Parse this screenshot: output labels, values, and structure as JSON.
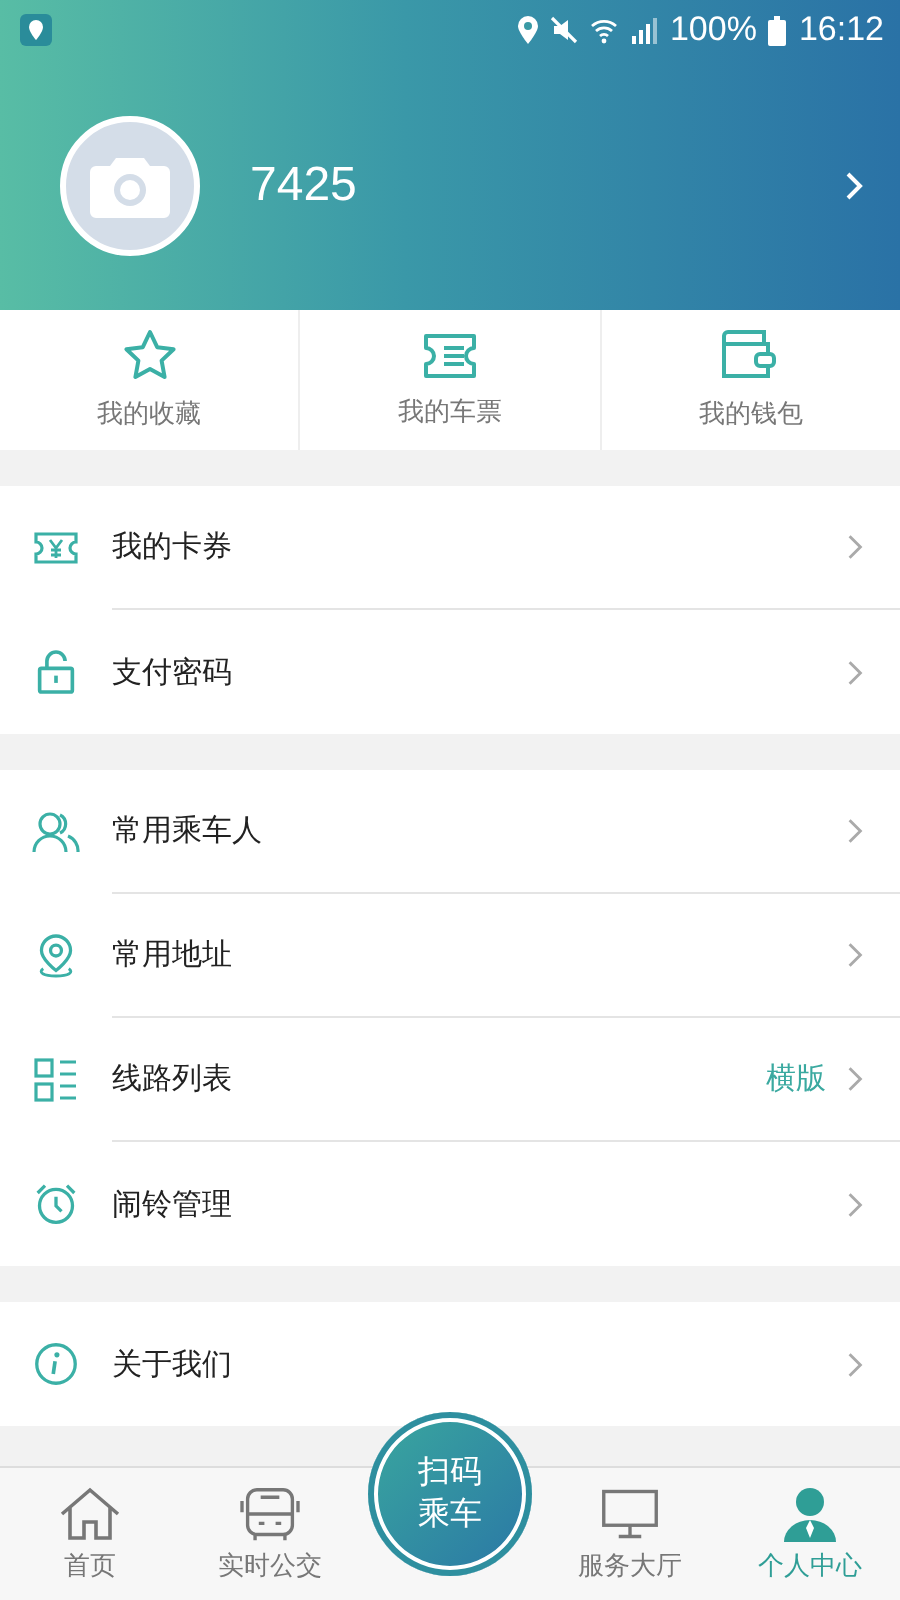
{
  "status_bar": {
    "battery": "100%",
    "time": "16:12"
  },
  "profile": {
    "name": "7425"
  },
  "quick_links": [
    {
      "label": "我的收藏"
    },
    {
      "label": "我的车票"
    },
    {
      "label": "我的钱包"
    }
  ],
  "menu_groups": [
    {
      "items": [
        {
          "label": "我的卡券"
        },
        {
          "label": "支付密码"
        }
      ]
    },
    {
      "items": [
        {
          "label": "常用乘车人"
        },
        {
          "label": "常用地址"
        },
        {
          "label": "线路列表",
          "value": "横版"
        },
        {
          "label": "闹铃管理"
        }
      ]
    },
    {
      "items": [
        {
          "label": "关于我们"
        }
      ]
    }
  ],
  "scan_button": {
    "lines": [
      "扫码",
      "乘车"
    ]
  },
  "tabs": [
    {
      "label": "首页",
      "selected": false
    },
    {
      "label": "实时公交",
      "selected": false
    },
    {
      "label": "服务大厅",
      "selected": false
    },
    {
      "label": "个人中心",
      "selected": true
    }
  ]
}
